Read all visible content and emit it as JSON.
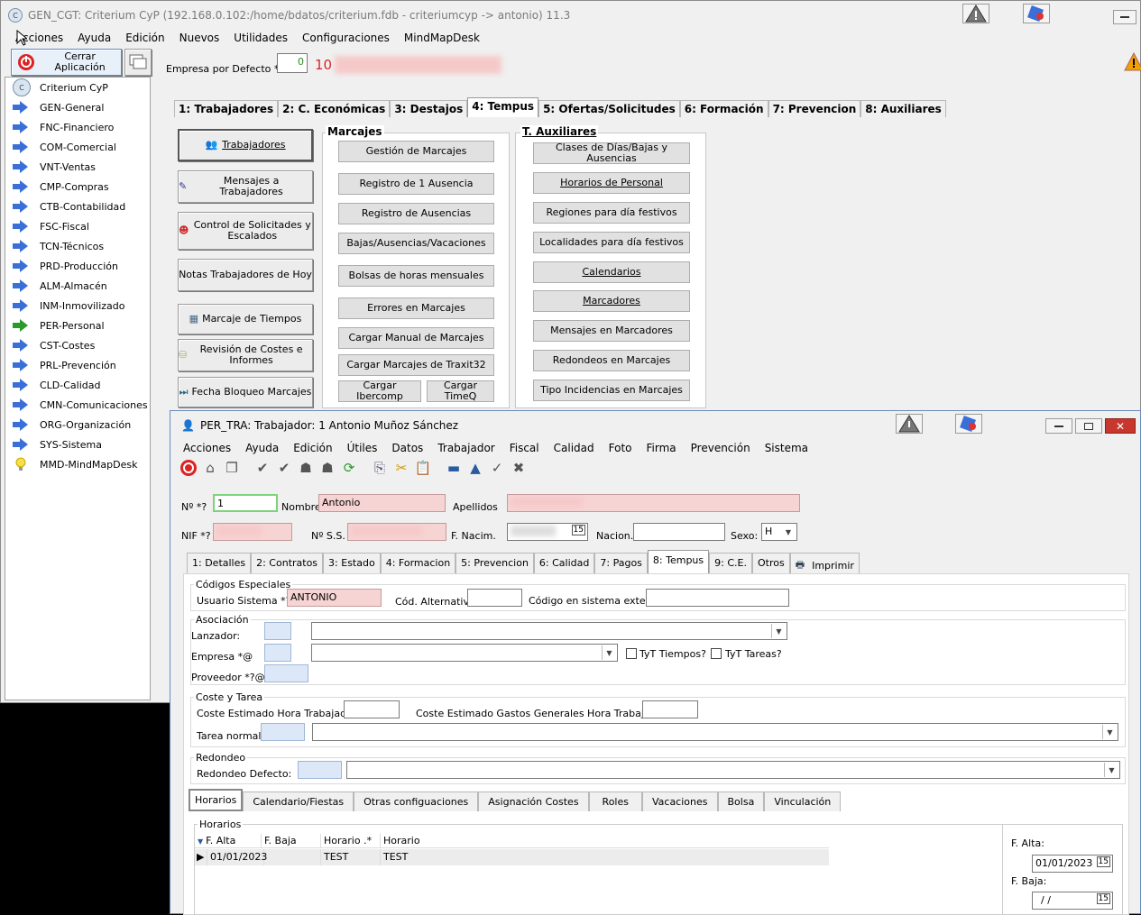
{
  "main": {
    "title": "GEN_CGT: Criterium CyP (192.168.0.102:/home/bdatos/criterium.fdb - criteriumcyp -> antonio) 11.3",
    "menu": [
      "Acciones",
      "Ayuda",
      "Edición",
      "Nuevos",
      "Utilidades",
      "Configuraciones",
      "MindMapDesk"
    ],
    "close_app": "Cerrar Aplicación",
    "empresa_label": "Empresa por Defecto *?",
    "empresa_value": "0",
    "empresa_code": "10",
    "sidebar": [
      "Criterium CyP",
      "GEN-General",
      "FNC-Financiero",
      "COM-Comercial",
      "VNT-Ventas",
      "CMP-Compras",
      "CTB-Contabilidad",
      "FSC-Fiscal",
      "TCN-Técnicos",
      "PRD-Producción",
      "ALM-Almacén",
      "INM-Inmovilizado",
      "PER-Personal",
      "CST-Costes",
      "PRL-Prevención",
      "CLD-Calidad",
      "CMN-Comunicaciones",
      "ORG-Organización",
      "SYS-Sistema",
      "MMD-MindMapDesk"
    ],
    "tabs": [
      "1: Trabajadores",
      "2: C. Económicas",
      "3: Destajos",
      "4: Tempus",
      "5: Ofertas/Solicitudes",
      "6: Formación",
      "7: Prevencion",
      "8: Auxiliares"
    ],
    "left_buttons": [
      "Trabajadores",
      "Mensajes a Trabajadores",
      "Control de Solicitades y Escalados",
      "Notas Trabajadores de Hoy",
      "Marcaje de Tiempos",
      "Revisión de Costes e Informes",
      "Fecha Bloqueo Marcajes"
    ],
    "marcajes_title": "Marcajes",
    "marcajes": [
      "Gestión de Marcajes",
      "Registro de 1 Ausencia",
      "Registro de Ausencias",
      "Bajas/Ausencias/Vacaciones",
      "Bolsas de horas mensuales",
      "Errores en Marcajes",
      "Cargar Manual de Marcajes",
      "Cargar Marcajes de Traxit32",
      "Cargar Ibercomp",
      "Cargar TimeQ"
    ],
    "aux_title": "T. Auxiliares",
    "aux": [
      "Clases de Días/Bajas y Ausencias",
      "Horarios de Personal",
      "Regiones para día festivos",
      "Localidades para día festivos",
      "Calendarios",
      "Marcadores",
      "Mensajes en Marcadores",
      "Redondeos en Marcajes",
      "Tipo Incidencias en Marcajes"
    ]
  },
  "child": {
    "title": "PER_TRA: Trabajador: 1 Antonio Muñoz Sánchez",
    "menu": [
      "Acciones",
      "Ayuda",
      "Edición",
      "Útiles",
      "Datos",
      "Trabajador",
      "Fiscal",
      "Calidad",
      "Foto",
      "Firma",
      "Prevención",
      "Sistema"
    ],
    "labels": {
      "num": "Nº *?",
      "nombre": "Nombre",
      "apellidos": "Apellidos",
      "nif": "NIF *?",
      "nss": "Nº S.S.",
      "fnac": "F. Nacim.",
      "nacion": "Nacion.",
      "sexo": "Sexo:"
    },
    "values": {
      "num": "1",
      "nombre": "Antonio",
      "sexo": "H"
    },
    "tabs": [
      "1: Detalles",
      "2: Contratos",
      "3: Estado",
      "4: Formacion",
      "5: Prevencion",
      "6: Calidad",
      "7: Pagos",
      "8: Tempus",
      "9: C.E.",
      "Otros",
      "Imprimir"
    ],
    "codigos": {
      "title": "Códigos Especiales",
      "usuario_label": "Usuario Sistema *?",
      "usuario_value": "ANTONIO",
      "alt_label": "Cód. Alternativo",
      "ext_label": "Código en sistema externo"
    },
    "asociacion": {
      "title": "Asociación",
      "lanzador": "Lanzador:",
      "empresa": "Empresa *@",
      "proveedor": "Proveedor *?@:",
      "tyt_tiempos": "TyT Tiempos?",
      "tyt_tareas": "TyT Tareas?"
    },
    "coste": {
      "title": "Coste y Tarea",
      "hora": "Coste Estimado Hora Trabajador:",
      "gastos": "Coste Estimado Gastos Generales Hora Trabajador:",
      "tarea": "Tarea normal:"
    },
    "redondeo": {
      "title": "Redondeo",
      "defecto": "Redondeo Defecto:"
    },
    "subtabs": [
      "Horarios",
      "Calendario/Fiestas",
      "Otras configuaciones",
      "Asignación Costes",
      "Roles",
      "Vacaciones",
      "Bolsa",
      "Vinculación"
    ],
    "horarios": {
      "title": "Horarios",
      "columns": [
        "F. Alta",
        "F. Baja",
        "Horario .*",
        "Horario"
      ],
      "rows": [
        [
          "01/01/2023",
          "",
          "TEST",
          "TEST"
        ]
      ],
      "falta_label": "F. Alta:",
      "falta_value": "01/01/2023",
      "fbaja_label": "F. Baja:",
      "fbaja_value": "/ /"
    }
  }
}
